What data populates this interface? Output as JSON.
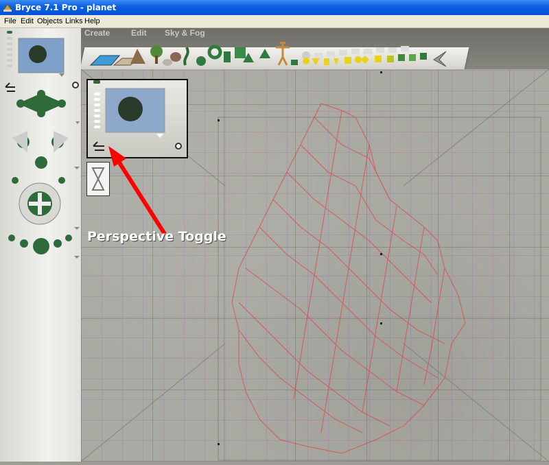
{
  "window": {
    "title": "Bryce 7.1  Pro - planet"
  },
  "menu": {
    "file": "File",
    "edit": "Edit",
    "objects": "Objects",
    "links": "Links",
    "help": "Help"
  },
  "palette_tabs": {
    "create": "Create",
    "edit": "Edit",
    "sky_fog": "Sky & Fog"
  },
  "annotation": {
    "label": "Perspective Toggle"
  },
  "colors": {
    "titlebar": "#0a5fe0",
    "wireframe": "#e0404a",
    "arrow": "#ff0000",
    "green_control": "#2f6b3a"
  },
  "icons": [
    "app-icon",
    "water-plane-icon",
    "terrain-icon",
    "tree-icon",
    "rock-icon",
    "sphere-icon",
    "torus-icon",
    "cube-icon",
    "cone-icon",
    "figure-icon",
    "perspective-toggle-icon"
  ]
}
